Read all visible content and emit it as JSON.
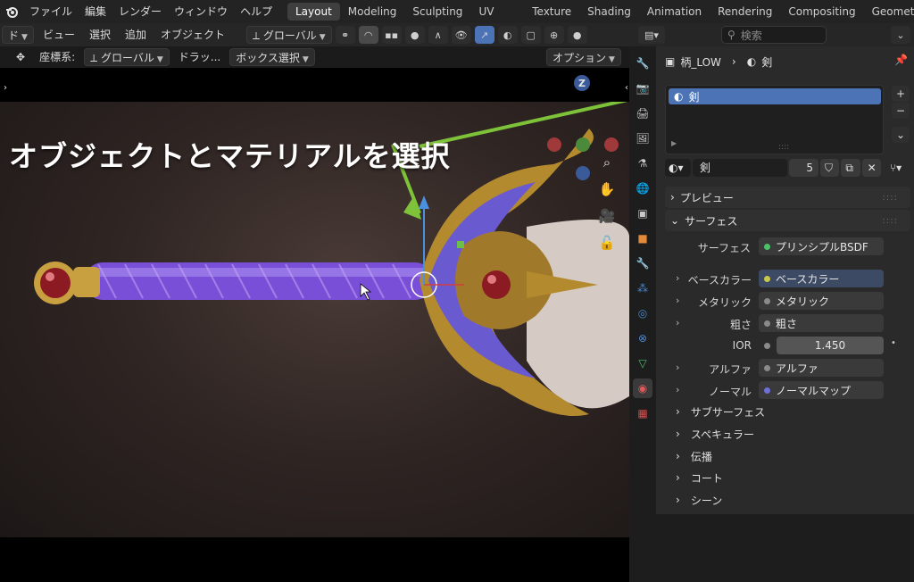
{
  "menubar": {
    "logo_icon": "blender-logo-icon",
    "items": [
      "ファイル",
      "編集",
      "レンダー",
      "ウィンドウ",
      "ヘルプ"
    ]
  },
  "workspaces": [
    "Layout",
    "Modeling",
    "Sculpting",
    "UV Editing",
    "Texture Paint",
    "Shading",
    "Animation",
    "Rendering",
    "Compositing",
    "Geometry"
  ],
  "viewport_header": {
    "mode_label": "ド",
    "view": "ビュー",
    "select": "選択",
    "add": "追加",
    "object": "オブジェクト",
    "orientation": "グローバル"
  },
  "viewport_header2": {
    "coord_label": "座標系:",
    "coord_value": "グローバル",
    "drag_label": "ドラッ...",
    "drag_value": "ボックス選択",
    "options": "オプション"
  },
  "overlay": {
    "instruction": "オブジェクトとマテリアルを選択"
  },
  "outliner": {
    "search_placeholder": "検索"
  },
  "properties": {
    "breadcrumb_object": "柄_LOW",
    "breadcrumb_material": "剣",
    "slot_name": "剣",
    "material_name": "剣",
    "user_count": "5",
    "panels": {
      "preview": "プレビュー",
      "surface": "サーフェス"
    },
    "surface_label": "サーフェス",
    "surface_value": "プリンシプルBSDF",
    "rows": [
      {
        "label": "ベースカラー",
        "value": "ベースカラー",
        "dot_color": "#c8c84a",
        "expand": true
      },
      {
        "label": "メタリック",
        "value": "メタリック",
        "dot_color": "#8a8a8a",
        "expand": true
      },
      {
        "label": "粗さ",
        "value": "粗さ",
        "dot_color": "#8a8a8a",
        "expand": true
      },
      {
        "label": "IOR",
        "value": "1.450",
        "dot_color": "#8a8a8a",
        "expand": false
      },
      {
        "label": "アルファ",
        "value": "アルファ",
        "dot_color": "#8a8a8a",
        "expand": true
      },
      {
        "label": "ノーマル",
        "value": "ノーマルマップ",
        "dot_color": "#6f6fd8",
        "expand": true
      }
    ],
    "subpanels": [
      "サブサーフェス",
      "スペキュラー",
      "伝播",
      "コート",
      "シーン"
    ]
  },
  "colors": {
    "accent_blue": "#4b73b5",
    "arrow_green": "#7ec23a"
  }
}
